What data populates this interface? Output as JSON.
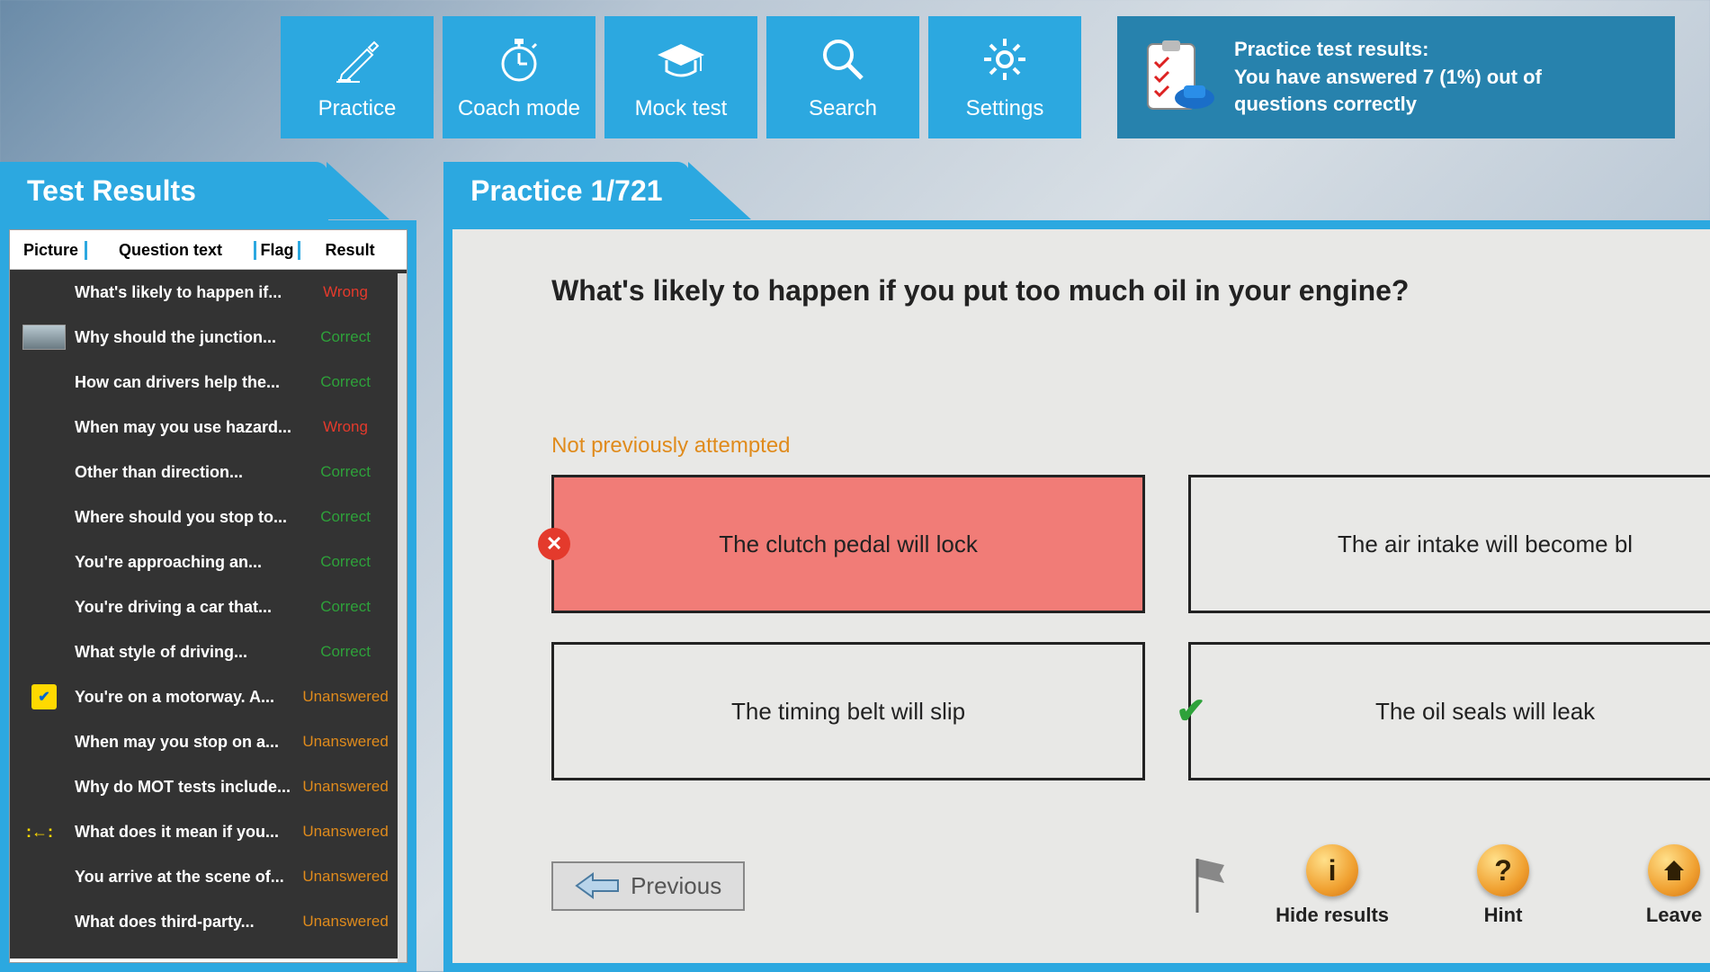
{
  "nav": {
    "practice": "Practice",
    "coach": "Coach mode",
    "mock": "Mock test",
    "search": "Search",
    "settings": "Settings"
  },
  "banner": {
    "line1": "Practice test results:",
    "line2": "You have answered 7 (1%) out of",
    "line3": "questions correctly"
  },
  "left": {
    "title": "Test Results",
    "headers": {
      "picture": "Picture",
      "question": "Question text",
      "flag": "Flag",
      "result": "Result"
    },
    "rows": [
      {
        "thumb": "",
        "q": "What's likely to happen if...",
        "r": "Wrong",
        "rc": "wrong"
      },
      {
        "thumb": "photo",
        "q": "Why should the junction...",
        "r": "Correct",
        "rc": "correct"
      },
      {
        "thumb": "",
        "q": "How can drivers help the...",
        "r": "Correct",
        "rc": "correct"
      },
      {
        "thumb": "",
        "q": "When may you use hazard...",
        "r": "Wrong",
        "rc": "wrong"
      },
      {
        "thumb": "",
        "q": "Other than direction...",
        "r": "Correct",
        "rc": "correct"
      },
      {
        "thumb": "",
        "q": "Where should you stop to...",
        "r": "Correct",
        "rc": "correct"
      },
      {
        "thumb": "",
        "q": "You're approaching an...",
        "r": "Correct",
        "rc": "correct"
      },
      {
        "thumb": "",
        "q": "You're driving a car that...",
        "r": "Correct",
        "rc": "correct"
      },
      {
        "thumb": "",
        "q": "What style of driving...",
        "r": "Correct",
        "rc": "correct"
      },
      {
        "thumb": "flag",
        "q": "You're on a motorway. A...",
        "r": "Unanswered",
        "rc": "unans"
      },
      {
        "thumb": "",
        "q": "When may you stop on a...",
        "r": "Unanswered",
        "rc": "unans"
      },
      {
        "thumb": "",
        "q": "Why do MOT tests include...",
        "r": "Unanswered",
        "rc": "unans"
      },
      {
        "thumb": "arrow",
        "q": "What does it mean if you...",
        "r": "Unanswered",
        "rc": "unans"
      },
      {
        "thumb": "",
        "q": "You arrive at the scene of...",
        "r": "Unanswered",
        "rc": "unans"
      },
      {
        "thumb": "",
        "q": "What does third-party...",
        "r": "Unanswered",
        "rc": "unans"
      }
    ]
  },
  "right": {
    "title": "Practice 1/721",
    "question": "What's likely to happen if you put too much oil in your engine?",
    "attempt": "Not previously attempted",
    "answers": {
      "a": "The clutch pedal will lock",
      "b": "The air intake will become bl",
      "c": "The timing belt will slip",
      "d": "The oil seals will leak"
    },
    "prev": "Previous",
    "hide": "Hide results",
    "hint": "Hint",
    "leave": "Leave"
  }
}
